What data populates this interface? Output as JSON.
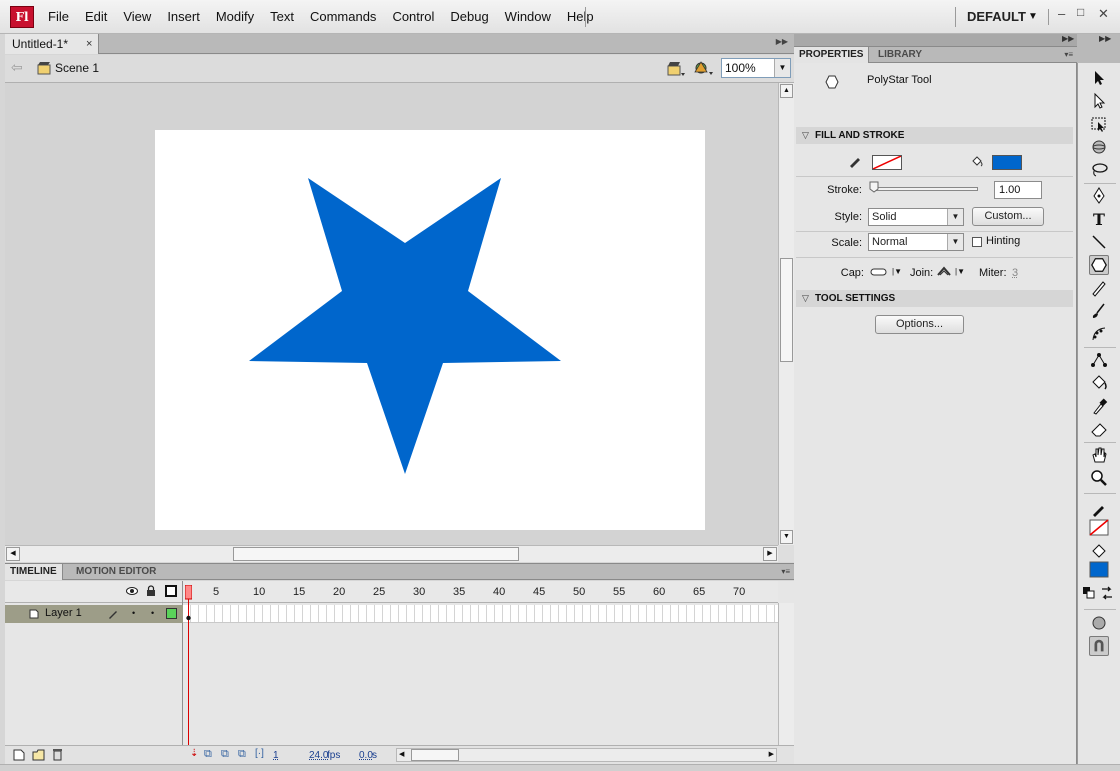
{
  "app": {
    "logo": "Fl",
    "workspace": "DEFAULT"
  },
  "menu": [
    "File",
    "Edit",
    "View",
    "Insert",
    "Modify",
    "Text",
    "Commands",
    "Control",
    "Debug",
    "Window",
    "Help"
  ],
  "document": {
    "tab_title": "Untitled-1*",
    "close": "×"
  },
  "editbar": {
    "scene": "Scene 1",
    "zoom": "100%"
  },
  "stage": {
    "star_color": "#0066cc",
    "stage_bg": "#ffffff"
  },
  "timeline": {
    "tabs": [
      "TIMELINE",
      "MOTION EDITOR"
    ],
    "frame_numbers": [
      "5",
      "10",
      "15",
      "20",
      "25",
      "30",
      "35",
      "40",
      "45",
      "50",
      "55",
      "60",
      "65",
      "70"
    ],
    "layer_name": "Layer 1",
    "current_frame": "1",
    "fps": "24.0",
    "fps_unit": "fps",
    "elapsed": "0.0",
    "elapsed_unit": "s"
  },
  "properties": {
    "tabs": [
      "PROPERTIES",
      "LIBRARY"
    ],
    "tool_name": "PolyStar Tool",
    "fill_stroke_title": "FILL AND STROKE",
    "fill_color": "#0066cc",
    "stroke_label": "Stroke:",
    "stroke_value": "1.00",
    "style_label": "Style:",
    "style_value": "Solid",
    "custom_button": "Custom...",
    "scale_label": "Scale:",
    "scale_value": "Normal",
    "hinting_label": "Hinting",
    "cap_label": "Cap:",
    "join_label": "Join:",
    "miter_label": "Miter:",
    "miter_value": "3",
    "tool_settings_title": "TOOL SETTINGS",
    "options_button": "Options..."
  }
}
